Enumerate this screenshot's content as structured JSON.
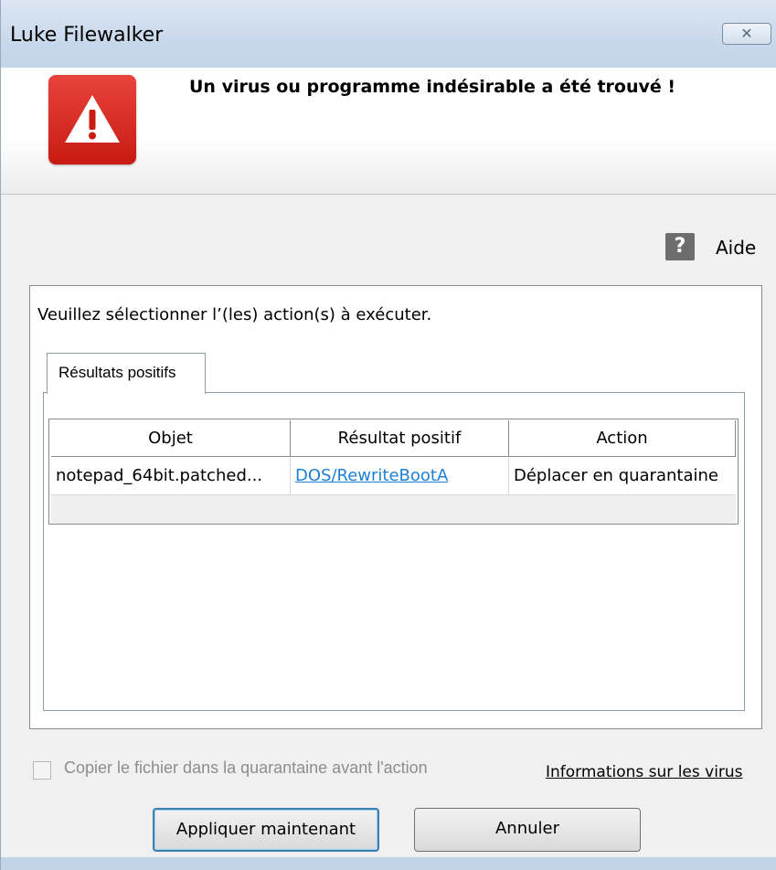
{
  "window": {
    "title": "Luke Filewalker",
    "close_glyph": "✕"
  },
  "banner": {
    "icon": "warning-triangle-icon",
    "title": "Un virus ou programme indésirable a été trouvé !"
  },
  "help": {
    "icon_glyph": "?",
    "label": "Aide"
  },
  "instruction": "Veuillez sélectionner l’(les) action(s) à exécuter.",
  "tabs": [
    {
      "label": "Résultats positifs",
      "selected": true
    }
  ],
  "table": {
    "columns": [
      "Objet",
      "Résultat positif",
      "Action"
    ],
    "rows": [
      {
        "object": "notepad_64bit.patched...",
        "result": "DOS/RewriteBootA",
        "action": "Déplacer en quarantaine"
      }
    ]
  },
  "options": {
    "copy_to_quarantine_label": "Copier le fichier dans la quarantaine avant l'action",
    "copy_to_quarantine_checked": false,
    "copy_to_quarantine_enabled": false,
    "virus_info_link": "Informations sur les virus"
  },
  "buttons": {
    "apply_label": "Appliquer maintenant",
    "cancel_label": "Annuler"
  },
  "colors": {
    "accent": "#3c7fb1",
    "warning_red": "#d32a21",
    "link": "#1e7fd4"
  }
}
